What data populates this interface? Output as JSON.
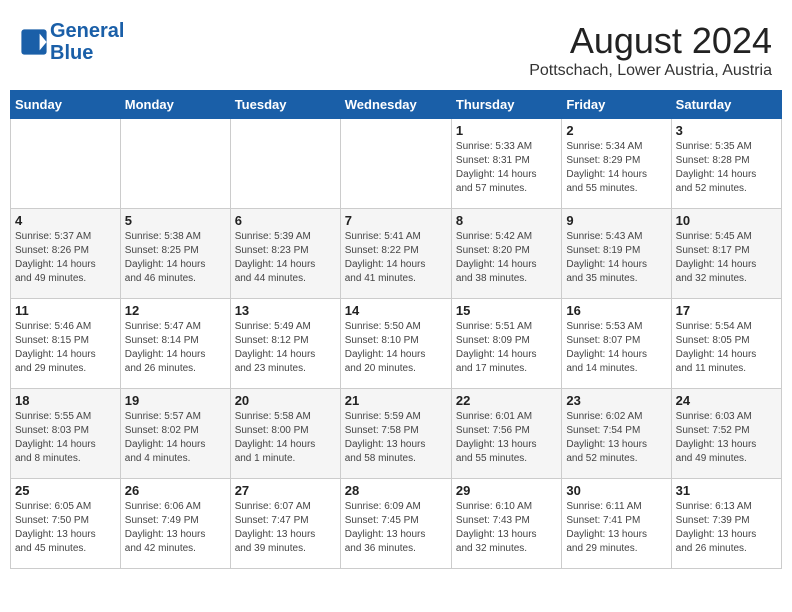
{
  "header": {
    "logo_line1": "General",
    "logo_line2": "Blue",
    "month_year": "August 2024",
    "location": "Pottschach, Lower Austria, Austria"
  },
  "weekdays": [
    "Sunday",
    "Monday",
    "Tuesday",
    "Wednesday",
    "Thursday",
    "Friday",
    "Saturday"
  ],
  "weeks": [
    [
      {
        "day": "",
        "info": ""
      },
      {
        "day": "",
        "info": ""
      },
      {
        "day": "",
        "info": ""
      },
      {
        "day": "",
        "info": ""
      },
      {
        "day": "1",
        "info": "Sunrise: 5:33 AM\nSunset: 8:31 PM\nDaylight: 14 hours\nand 57 minutes."
      },
      {
        "day": "2",
        "info": "Sunrise: 5:34 AM\nSunset: 8:29 PM\nDaylight: 14 hours\nand 55 minutes."
      },
      {
        "day": "3",
        "info": "Sunrise: 5:35 AM\nSunset: 8:28 PM\nDaylight: 14 hours\nand 52 minutes."
      }
    ],
    [
      {
        "day": "4",
        "info": "Sunrise: 5:37 AM\nSunset: 8:26 PM\nDaylight: 14 hours\nand 49 minutes."
      },
      {
        "day": "5",
        "info": "Sunrise: 5:38 AM\nSunset: 8:25 PM\nDaylight: 14 hours\nand 46 minutes."
      },
      {
        "day": "6",
        "info": "Sunrise: 5:39 AM\nSunset: 8:23 PM\nDaylight: 14 hours\nand 44 minutes."
      },
      {
        "day": "7",
        "info": "Sunrise: 5:41 AM\nSunset: 8:22 PM\nDaylight: 14 hours\nand 41 minutes."
      },
      {
        "day": "8",
        "info": "Sunrise: 5:42 AM\nSunset: 8:20 PM\nDaylight: 14 hours\nand 38 minutes."
      },
      {
        "day": "9",
        "info": "Sunrise: 5:43 AM\nSunset: 8:19 PM\nDaylight: 14 hours\nand 35 minutes."
      },
      {
        "day": "10",
        "info": "Sunrise: 5:45 AM\nSunset: 8:17 PM\nDaylight: 14 hours\nand 32 minutes."
      }
    ],
    [
      {
        "day": "11",
        "info": "Sunrise: 5:46 AM\nSunset: 8:15 PM\nDaylight: 14 hours\nand 29 minutes."
      },
      {
        "day": "12",
        "info": "Sunrise: 5:47 AM\nSunset: 8:14 PM\nDaylight: 14 hours\nand 26 minutes."
      },
      {
        "day": "13",
        "info": "Sunrise: 5:49 AM\nSunset: 8:12 PM\nDaylight: 14 hours\nand 23 minutes."
      },
      {
        "day": "14",
        "info": "Sunrise: 5:50 AM\nSunset: 8:10 PM\nDaylight: 14 hours\nand 20 minutes."
      },
      {
        "day": "15",
        "info": "Sunrise: 5:51 AM\nSunset: 8:09 PM\nDaylight: 14 hours\nand 17 minutes."
      },
      {
        "day": "16",
        "info": "Sunrise: 5:53 AM\nSunset: 8:07 PM\nDaylight: 14 hours\nand 14 minutes."
      },
      {
        "day": "17",
        "info": "Sunrise: 5:54 AM\nSunset: 8:05 PM\nDaylight: 14 hours\nand 11 minutes."
      }
    ],
    [
      {
        "day": "18",
        "info": "Sunrise: 5:55 AM\nSunset: 8:03 PM\nDaylight: 14 hours\nand 8 minutes."
      },
      {
        "day": "19",
        "info": "Sunrise: 5:57 AM\nSunset: 8:02 PM\nDaylight: 14 hours\nand 4 minutes."
      },
      {
        "day": "20",
        "info": "Sunrise: 5:58 AM\nSunset: 8:00 PM\nDaylight: 14 hours\nand 1 minute."
      },
      {
        "day": "21",
        "info": "Sunrise: 5:59 AM\nSunset: 7:58 PM\nDaylight: 13 hours\nand 58 minutes."
      },
      {
        "day": "22",
        "info": "Sunrise: 6:01 AM\nSunset: 7:56 PM\nDaylight: 13 hours\nand 55 minutes."
      },
      {
        "day": "23",
        "info": "Sunrise: 6:02 AM\nSunset: 7:54 PM\nDaylight: 13 hours\nand 52 minutes."
      },
      {
        "day": "24",
        "info": "Sunrise: 6:03 AM\nSunset: 7:52 PM\nDaylight: 13 hours\nand 49 minutes."
      }
    ],
    [
      {
        "day": "25",
        "info": "Sunrise: 6:05 AM\nSunset: 7:50 PM\nDaylight: 13 hours\nand 45 minutes."
      },
      {
        "day": "26",
        "info": "Sunrise: 6:06 AM\nSunset: 7:49 PM\nDaylight: 13 hours\nand 42 minutes."
      },
      {
        "day": "27",
        "info": "Sunrise: 6:07 AM\nSunset: 7:47 PM\nDaylight: 13 hours\nand 39 minutes."
      },
      {
        "day": "28",
        "info": "Sunrise: 6:09 AM\nSunset: 7:45 PM\nDaylight: 13 hours\nand 36 minutes."
      },
      {
        "day": "29",
        "info": "Sunrise: 6:10 AM\nSunset: 7:43 PM\nDaylight: 13 hours\nand 32 minutes."
      },
      {
        "day": "30",
        "info": "Sunrise: 6:11 AM\nSunset: 7:41 PM\nDaylight: 13 hours\nand 29 minutes."
      },
      {
        "day": "31",
        "info": "Sunrise: 6:13 AM\nSunset: 7:39 PM\nDaylight: 13 hours\nand 26 minutes."
      }
    ]
  ]
}
